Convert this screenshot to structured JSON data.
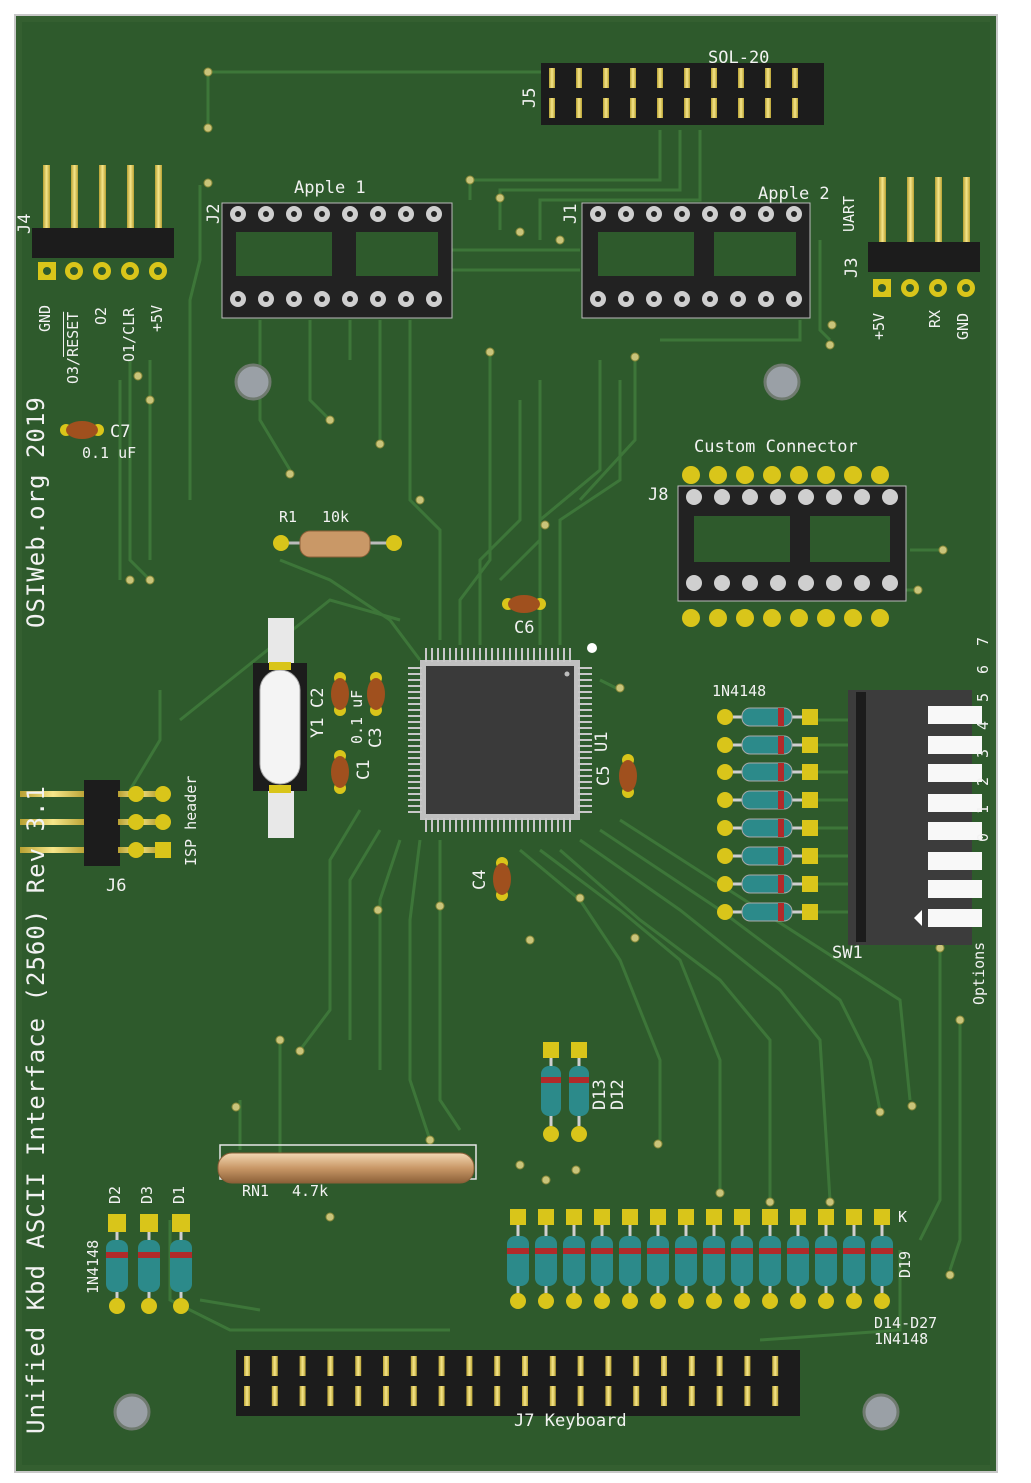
{
  "board": {
    "title": "Unified Kbd ASCII Interface (2560) Rev 3.1",
    "credit": "OSIWeb.org 2019"
  },
  "colors": {
    "pcb": "#2e5a2c",
    "trace": "#3f7a3b",
    "silkscreen": "#f2f2f2",
    "pad_gold": "#d9c51a",
    "ic_body": "#3a3a3a",
    "header_black": "#1c1c1c"
  },
  "components": {
    "j5": {
      "ref": "J5",
      "name": "SOL-20"
    },
    "j2": {
      "ref": "J2",
      "name": "Apple 1"
    },
    "j1": {
      "ref": "J1",
      "name": "Apple 2"
    },
    "j4": {
      "ref": "J4",
      "pins": [
        "GND",
        "O3/RESET",
        "O2",
        "O1/CLR",
        "+5V"
      ]
    },
    "j3": {
      "ref": "J3",
      "name": "UART",
      "pins": [
        "+5V",
        "RX",
        "GND"
      ]
    },
    "c7": {
      "ref": "C7",
      "value": "0.1 uF"
    },
    "j8": {
      "ref": "J8",
      "name": "Custom Connector"
    },
    "r1": {
      "ref": "R1",
      "value": "10k"
    },
    "c6": {
      "ref": "C6"
    },
    "y1": {
      "ref": "Y1"
    },
    "c2": {
      "ref": "C2"
    },
    "c3": {
      "ref": "C3"
    },
    "c1": {
      "ref": "C1"
    },
    "cap_value": "0.1 uF",
    "u1": {
      "ref": "U1"
    },
    "c5": {
      "ref": "C5"
    },
    "c4": {
      "ref": "C4"
    },
    "diode_array_label": "1N4148",
    "sw1": {
      "ref": "SW1",
      "label": "Options",
      "positions": [
        "7",
        "6",
        "5",
        "4",
        "3",
        "2",
        "1",
        "0"
      ]
    },
    "j6": {
      "ref": "J6",
      "name": "ISP header"
    },
    "d13": {
      "ref": "D13"
    },
    "d12": {
      "ref": "D12"
    },
    "rn1": {
      "ref": "RN1",
      "value": "4.7k"
    },
    "d2": {
      "ref": "D2"
    },
    "d3": {
      "ref": "D3"
    },
    "d1": {
      "ref": "D1"
    },
    "left_diode_value": "1N4148",
    "d19": {
      "ref": "D19"
    },
    "k_mark": "K",
    "diode_range": "D14-D27",
    "diode_range_value": "1N4148",
    "j7": {
      "ref": "J7",
      "name": "Keyboard"
    }
  }
}
